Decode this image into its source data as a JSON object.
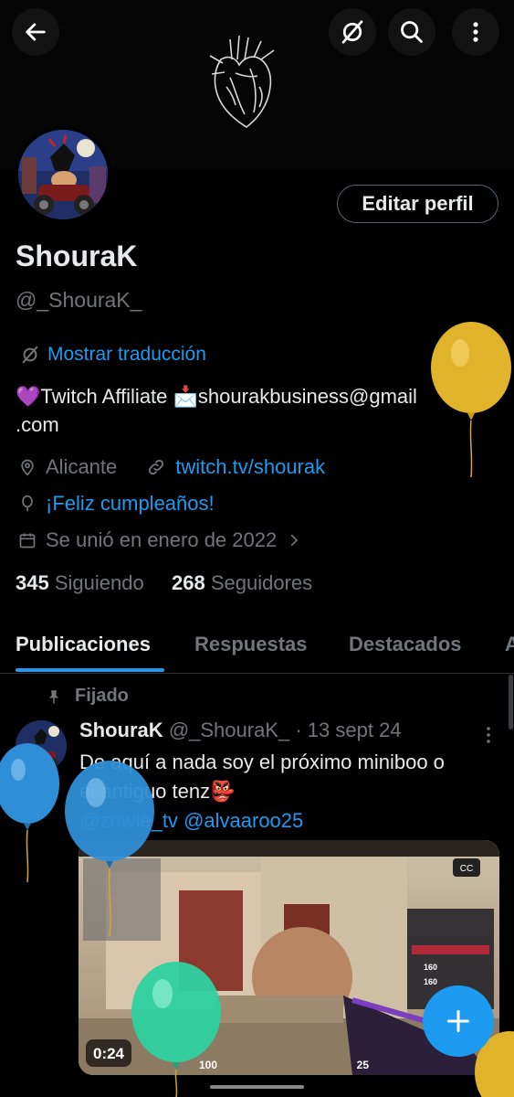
{
  "header": {
    "back_icon": "arrow-left-icon",
    "translate_icon": "translate-off-icon",
    "search_icon": "search-icon",
    "more_icon": "more-vertical-icon"
  },
  "profile": {
    "name": "ShouraK",
    "handle": "@_ShouraK_",
    "edit_label": "Editar perfil",
    "translate_label": "Mostrar traducción",
    "bio_line1_emoji": "💜",
    "bio_line1_text": "Twitch Affiliate ",
    "bio_line1_emoji2": "📩",
    "bio_line1_email": "shourakbusiness@gmail",
    "bio_line2": ".com",
    "location": "Alicante",
    "link": "twitch.tv/shourak",
    "birthday": "¡Feliz cumpleaños!",
    "joined": "Se unió en enero de 2022",
    "following_count": "345",
    "following_label": "Siguiendo",
    "followers_count": "268",
    "followers_label": "Seguidores"
  },
  "tabs": [
    {
      "label": "Publicaciones",
      "active": true
    },
    {
      "label": "Respuestas",
      "active": false
    },
    {
      "label": "Destacados",
      "active": false
    },
    {
      "label": "A",
      "active": false
    }
  ],
  "tweet": {
    "pinned_label": "Fijado",
    "author_name": "ShouraK",
    "author_handle": "@_ShouraK_",
    "date": "· 13 sept 24",
    "text_line1": "De aquí a nada soy el próximo miniboo o",
    "text_line2": "el antiguo tenz👺",
    "mention1": "@zowie_tv",
    "mention2": "@alvaaroo25",
    "video_duration": "0:24",
    "cc_label": "CC",
    "hud_health": "100",
    "hud_ammo": "25",
    "hud_cost1": "160",
    "hud_cost2": "160"
  },
  "fab": {
    "icon": "plus-icon"
  },
  "colors": {
    "accent": "#1d9bf0",
    "background": "#000000",
    "muted": "#71767b"
  }
}
